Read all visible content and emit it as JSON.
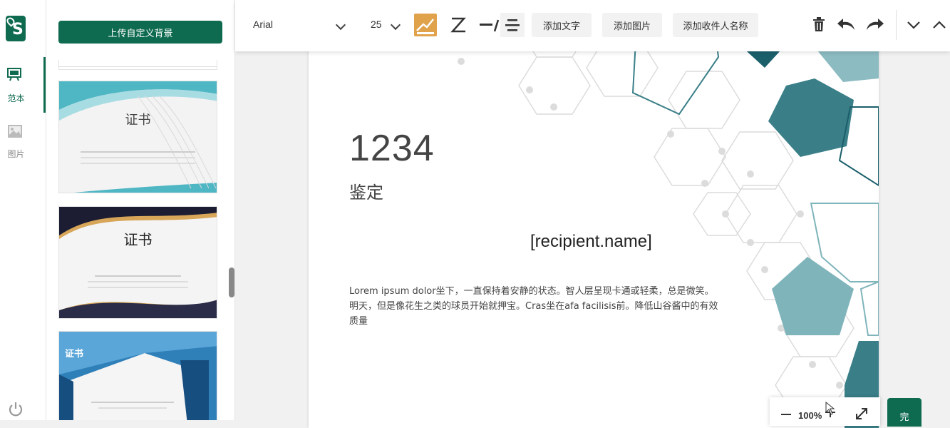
{
  "rail": {
    "items": [
      {
        "label": "范本",
        "icon": "template-board-icon",
        "active": true
      },
      {
        "label": "图片",
        "icon": "image-icon",
        "active": false
      }
    ]
  },
  "panel": {
    "upload_button": "上传自定义背景",
    "thumbnails": [
      {
        "title": "证书"
      },
      {
        "title": "证书"
      },
      {
        "title": "证书"
      }
    ]
  },
  "toolbar": {
    "font_family": "Arial",
    "font_size": "25",
    "add_text": "添加文字",
    "add_image": "添加图片",
    "add_recipient_name": "添加收件人名称"
  },
  "certificate": {
    "number": "1234",
    "title": "鉴定",
    "recipient": "[recipient.name]",
    "body": "Lorem ipsum dolor坐下，一直保持着安静的状态。智人层呈现卡通或轻柔，总是微笑。明天，但是像花生之类的球员开始就押宝。Cras坐在afa facilisis前。降低山谷酱中的有效质量"
  },
  "zoom": {
    "level": "100%"
  },
  "done_button": "完",
  "colors": {
    "brand": "#0f6b50",
    "teal_dark": "#1b5f6b",
    "teal_mid": "#3a7f88",
    "teal_light": "#7fb4bb"
  }
}
